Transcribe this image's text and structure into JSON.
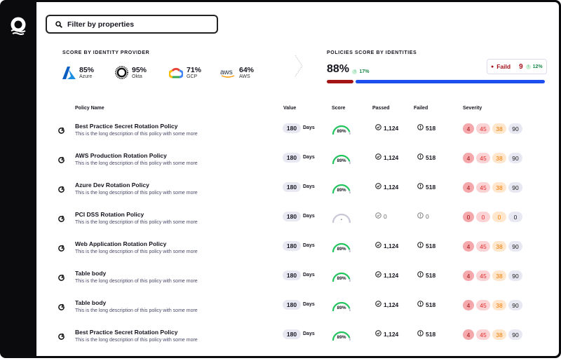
{
  "search": {
    "placeholder": "Filter by properties"
  },
  "providers_section": {
    "title": "SCORE BY IDENTITY PROVIDER",
    "items": [
      {
        "name": "Azure",
        "score": "85%"
      },
      {
        "name": "Okta",
        "score": "95%"
      },
      {
        "name": "GCP",
        "score": "71%"
      },
      {
        "name": "AWS",
        "score": "64%"
      }
    ]
  },
  "identities_section": {
    "title": "POLICIES SCORE BY IDENTITIES",
    "score": "88%",
    "delta": "17%",
    "failed_label": "Faild",
    "failed_count": "9",
    "failed_delta": "12%",
    "failed_fraction": 0.12,
    "colors": {
      "failed": "#a41414",
      "passed": "#1c4ef0"
    }
  },
  "table": {
    "headers": {
      "name": "Policy Name",
      "value": "Value",
      "score": "Score",
      "passed": "Passed",
      "failed": "Failed",
      "severity": "Severity"
    },
    "rows": [
      {
        "title": "Best Practice Secret Rotation Policy",
        "desc": "This is the long description of this policy with some more",
        "value": "180",
        "unit": "Days",
        "score": "89%",
        "score_frac": 0.89,
        "passed": "1,124",
        "failed": "518",
        "sev": [
          "4",
          "45",
          "38",
          "90"
        ]
      },
      {
        "title": "AWS Production Rotation Policy",
        "desc": "This is the long description of this policy with some more",
        "value": "180",
        "unit": "Days",
        "score": "89%",
        "score_frac": 0.89,
        "passed": "1,124",
        "failed": "518",
        "sev": [
          "4",
          "45",
          "38",
          "90"
        ]
      },
      {
        "title": "Azure Dev Rotation Policy",
        "desc": "This is the long description of this policy with some more",
        "value": "180",
        "unit": "Days",
        "score": "89%",
        "score_frac": 0.89,
        "passed": "1,124",
        "failed": "518",
        "sev": [
          "4",
          "45",
          "38",
          "90"
        ]
      },
      {
        "title": "PCI DSS Rotation Policy",
        "desc": "This is the long description of this policy with some more",
        "value": "180",
        "unit": "Days",
        "score": "-",
        "score_frac": 0,
        "passed": "0",
        "failed": "0",
        "sev": [
          "0",
          "0",
          "0",
          "0"
        ]
      },
      {
        "title": "Web Application Rotation Policy",
        "desc": "This is the long description of this policy with some more",
        "value": "180",
        "unit": "Days",
        "score": "89%",
        "score_frac": 0.89,
        "passed": "1,124",
        "failed": "518",
        "sev": [
          "4",
          "45",
          "38",
          "90"
        ]
      },
      {
        "title": "Table body",
        "desc": "This is the long description of this policy with some more",
        "value": "180",
        "unit": "Days",
        "score": "89%",
        "score_frac": 0.89,
        "passed": "1,124",
        "failed": "518",
        "sev": [
          "4",
          "45",
          "38",
          "90"
        ]
      },
      {
        "title": "Table body",
        "desc": "This is the long description of this policy with some more",
        "value": "180",
        "unit": "Days",
        "score": "89%",
        "score_frac": 0.89,
        "passed": "1,124",
        "failed": "518",
        "sev": [
          "4",
          "45",
          "38",
          "90"
        ]
      },
      {
        "title": "Best Practice Secret Rotation Policy",
        "desc": "This is the long description of this policy with some more",
        "value": "180",
        "unit": "Days",
        "score": "89%",
        "score_frac": 0.89,
        "passed": "1,124",
        "failed": "518",
        "sev": [
          "4",
          "45",
          "38",
          "90"
        ]
      }
    ]
  }
}
